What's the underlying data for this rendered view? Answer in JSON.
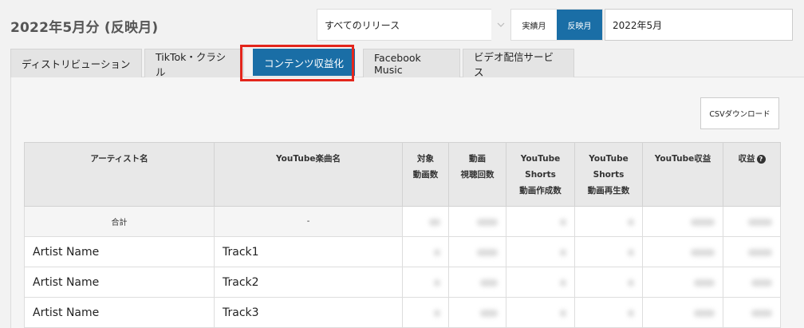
{
  "header": {
    "title": "2022年5月分 (反映月)",
    "release_select": "すべてのリリース",
    "toggle": {
      "actual": "実績月",
      "reflected": "反映月"
    },
    "month": "2022年5月"
  },
  "tabs": [
    {
      "label": "ディストリビューション"
    },
    {
      "label": "TikTok・クラシル"
    },
    {
      "label": "コンテンツ収益化"
    },
    {
      "label": "Facebook Music"
    },
    {
      "label": "ビデオ配信サービス"
    }
  ],
  "csv_button": "CSVダウンロード",
  "table": {
    "headers": {
      "artist": "アーティスト名",
      "track": "YouTube楽曲名",
      "target_line1": "対象",
      "target_line2": "動画数",
      "views_line1": "動画",
      "views_line2": "視聴回数",
      "shorts_created_line1": "YouTube",
      "shorts_created_line2": "Shorts",
      "shorts_created_line3": "動画作成数",
      "shorts_plays_line1": "YouTube",
      "shorts_plays_line2": "Shorts",
      "shorts_plays_line3": "動画再生数",
      "yt_revenue": "YouTube収益",
      "revenue": "収益"
    },
    "total_row": {
      "label": "合計",
      "track": "-"
    },
    "rows": [
      {
        "artist": "Artist Name",
        "track": "Track1"
      },
      {
        "artist": "Artist Name",
        "track": "Track2"
      },
      {
        "artist": "Artist Name",
        "track": "Track3"
      }
    ]
  },
  "colors": {
    "accent": "#1a6ea6",
    "highlight": "#e3261c"
  }
}
